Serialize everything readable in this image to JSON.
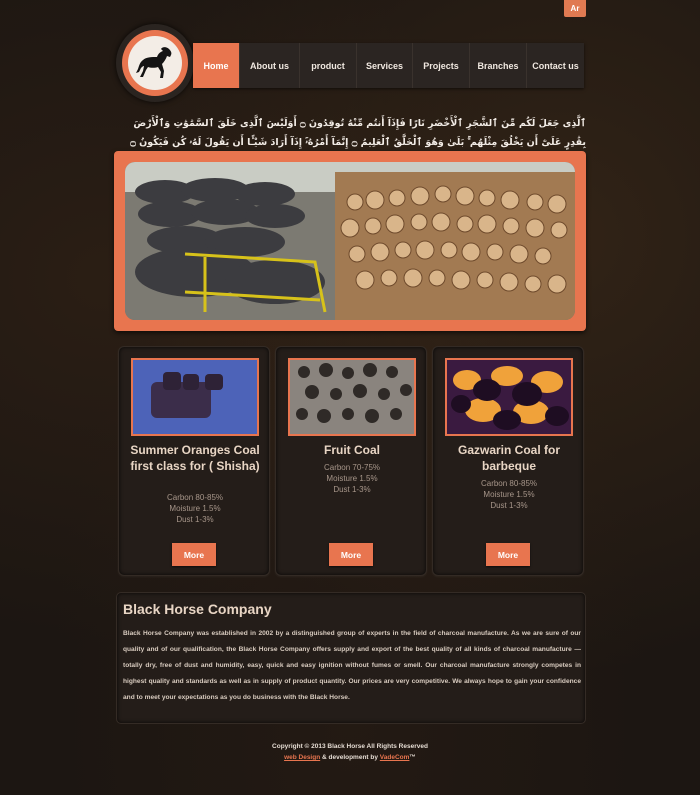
{
  "header": {
    "lang_button": "Ar",
    "logo_name": "horse-logo"
  },
  "nav": {
    "items": [
      {
        "label": "Home",
        "active": true
      },
      {
        "label": "About us",
        "active": false
      },
      {
        "label": "product",
        "active": false
      },
      {
        "label": "Services",
        "active": false
      },
      {
        "label": "Projects",
        "active": false
      },
      {
        "label": "Branches",
        "active": false
      },
      {
        "label": "Contact us",
        "active": false
      }
    ]
  },
  "quote": {
    "text": "ٱلَّذِى جَعَلَ لَكُم مِّنَ ٱلشَّجَرِ ٱلْأَخْضَرِ نَارًا فَإِذَآ أَنتُم مِّنْهُ تُوقِدُونَ ۝ أَوَلَيْسَ ٱلَّذِى خَلَقَ ٱلسَّمَٰوَٰتِ وَٱلْأَرْضَ بِقَٰدِرٍ عَلَىٰٓ أَن يَخْلُقَ مِثْلَهُم ۚ بَلَىٰ وَهُوَ ٱلْخَلَّٰقُ ٱلْعَلِيمُ ۝ إِنَّمَآ أَمْرُهُۥٓ إِذَآ أَرَادَ شَيْـًٔا أَن يَقُولَ لَهُۥ كُن فَيَكُونُ ۝ فَسُبْحَٰنَ ٱلَّذِى بِيَدِهِۦ مَلَكُوتُ كُلِّ شَىْءٍ وَإِلَيْهِ تُرْجَعُونَ"
  },
  "products": [
    {
      "title": "Summer Oranges Coal first class for ( Shisha)",
      "carbon": "Carbon 80-85%",
      "moisture": "Moisture 1.5%",
      "dust": "Dust 1-3%",
      "more": "More"
    },
    {
      "title": "Fruit Coal",
      "carbon": "Carbon 70-75%",
      "moisture": "Moisture 1.5%",
      "dust": "Dust 1-3%",
      "more": "More"
    },
    {
      "title": "Gazwarin Coal for barbeque",
      "carbon": "Carbon 80-85%",
      "moisture": "Moisture 1.5%",
      "dust": "Dust 1-3%",
      "more": "More"
    }
  ],
  "about": {
    "title": "Black Horse Company",
    "text": "Black Horse Company was established in 2002 by a distinguished group of experts in the field of charcoal manufacture. As we are sure of our quality and of our qualification, the Black Horse Company offers supply and export of the best quality of all kinds of charcoal manufacture —totally dry, free of dust and humidity, easy, quick and easy ignition without fumes or smell. Our charcoal manufacture strongly competes in highest quality and standards as well as in supply of product quantity. Our prices are very competitive. We always hope to gain your confidence and to meet your expectations as you do business with the Black Horse."
  },
  "footer": {
    "copyright": "Copyright © 2013 Black Horse All Rights Reserved",
    "web_design": "web Design",
    "mid": "& development by",
    "company": "VadeCom",
    "tm": "™"
  },
  "colors": {
    "accent": "#e8754f",
    "background": "#1c1612",
    "panel": "#241d19"
  }
}
